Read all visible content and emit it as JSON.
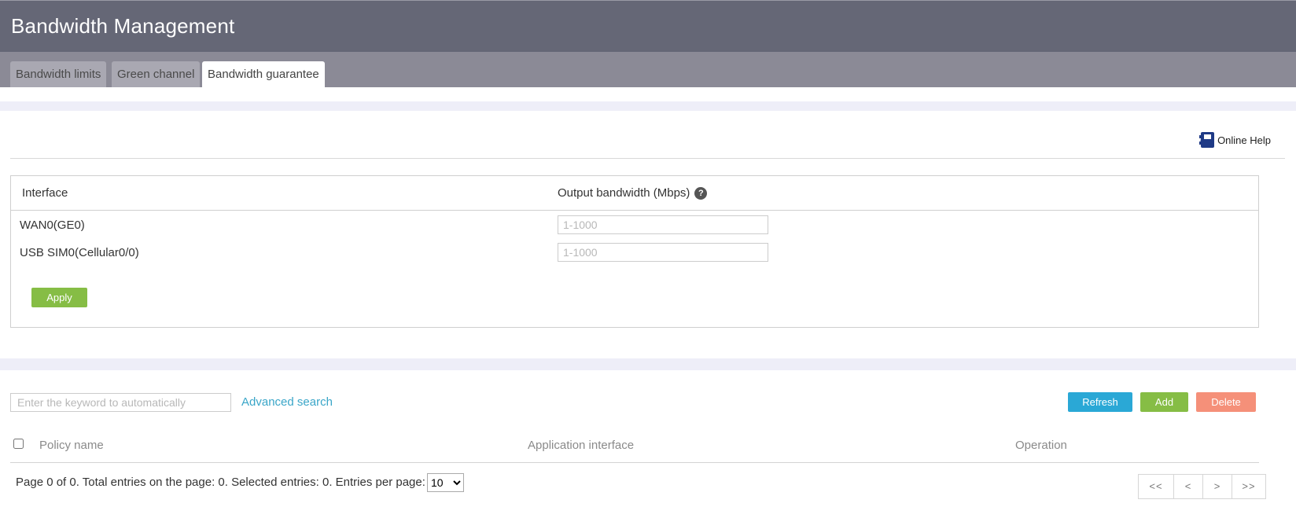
{
  "header": {
    "title": "Bandwidth Management"
  },
  "tabs": [
    {
      "label": "Bandwidth limits"
    },
    {
      "label": "Green channel"
    },
    {
      "label": "Bandwidth guarantee"
    }
  ],
  "help": {
    "label": "Online Help",
    "icon": "book-icon"
  },
  "panel": {
    "col_interface": "Interface",
    "col_bandwidth": "Output bandwidth (Mbps)",
    "help_glyph": "?",
    "rows": [
      {
        "interface": "WAN0(GE0)",
        "placeholder": "1-1000",
        "value": ""
      },
      {
        "interface": "USB SIM0(Cellular0/0)",
        "placeholder": "1-1000",
        "value": ""
      }
    ],
    "apply_label": "Apply"
  },
  "search": {
    "placeholder": "Enter the keyword to automatically",
    "advanced_label": "Advanced search"
  },
  "actions": {
    "refresh": "Refresh",
    "add": "Add",
    "delete": "Delete"
  },
  "table": {
    "headers": [
      "Policy name",
      "Application interface",
      "Operation"
    ]
  },
  "footer": {
    "summary": "Page 0 of 0. Total entries on the page: 0. Selected entries: 0. Entries per page:",
    "per_page": "10",
    "pager": [
      "<<",
      "<",
      ">",
      ">>"
    ]
  },
  "colors": {
    "header_bg": "#656776",
    "tabbar_bg": "#8b8a96",
    "refresh": "#2aa8d6",
    "add": "#86bd45",
    "delete": "#f59079",
    "link": "#3aa6c8"
  }
}
